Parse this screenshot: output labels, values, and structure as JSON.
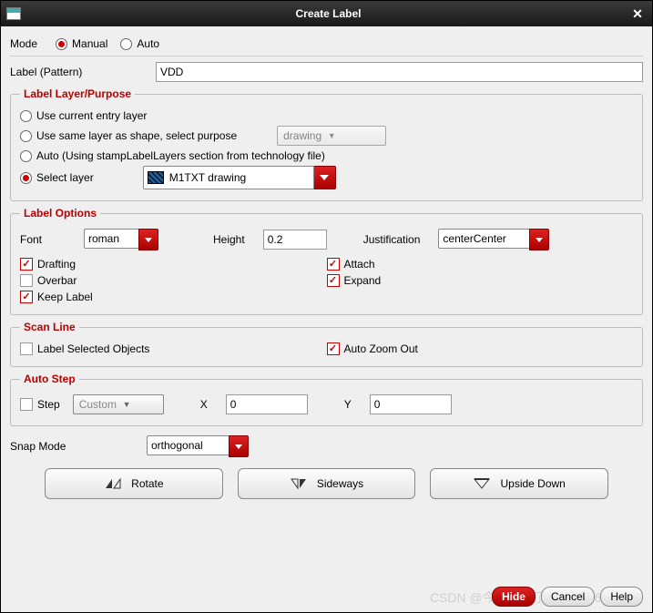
{
  "window": {
    "title": "Create Label"
  },
  "mode": {
    "label": "Mode",
    "manual": "Manual",
    "auto": "Auto",
    "selected": "manual"
  },
  "pattern": {
    "label": "Label (Pattern)",
    "value": "VDD"
  },
  "layer": {
    "legend": "Label Layer/Purpose",
    "opt_current": "Use current entry layer",
    "opt_same": "Use same layer as shape, select purpose",
    "purpose_value": "drawing",
    "opt_auto": "Auto (Using stampLabelLayers section from technology file)",
    "opt_select": "Select layer",
    "layer_value": "M1TXT drawing",
    "selected": "select"
  },
  "options": {
    "legend": "Label Options",
    "font_label": "Font",
    "font_value": "roman",
    "height_label": "Height",
    "height_value": "0.2",
    "just_label": "Justification",
    "just_value": "centerCenter",
    "drafting": "Drafting",
    "overbar": "Overbar",
    "keep": "Keep Label",
    "attach": "Attach",
    "expand": "Expand",
    "drafting_on": true,
    "overbar_on": false,
    "keep_on": true,
    "attach_on": true,
    "expand_on": true
  },
  "scan": {
    "legend": "Scan Line",
    "lblsel": "Label Selected Objects",
    "lblsel_on": false,
    "autozoom": "Auto Zoom Out",
    "autozoom_on": true
  },
  "autostep": {
    "legend": "Auto Step",
    "step": "Step",
    "step_on": false,
    "step_value": "Custom",
    "x_label": "X",
    "x_value": "0",
    "y_label": "Y",
    "y_value": "0"
  },
  "snap": {
    "label": "Snap Mode",
    "value": "orthogonal"
  },
  "buttons": {
    "rotate": "Rotate",
    "sideways": "Sideways",
    "upside": "Upside Down"
  },
  "footer": {
    "hide": "Hide",
    "cancel": "Cancel",
    "help": "Help"
  },
  "watermark": "CSDN @今天学习了吗20220620"
}
